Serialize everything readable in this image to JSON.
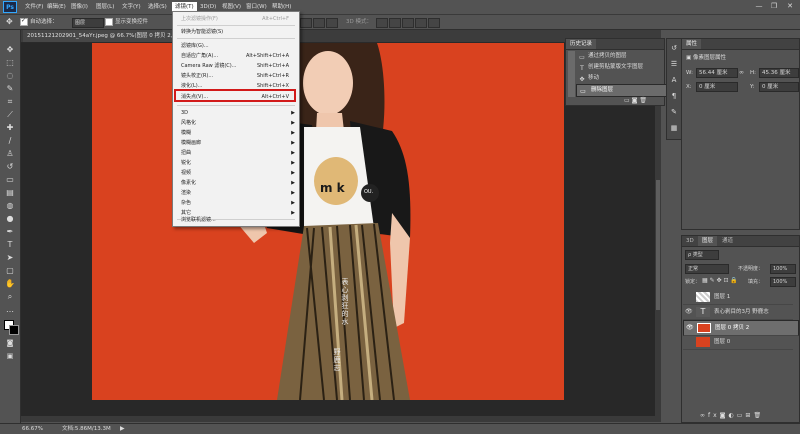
{
  "menubar": {
    "items": [
      "文件(F)",
      "编辑(E)",
      "图像(I)",
      "图层(L)",
      "文字(Y)",
      "选择(S)",
      "滤镜(T)",
      "3D(D)",
      "视图(V)",
      "窗口(W)",
      "帮助(H)"
    ],
    "active_index": 6,
    "window_controls": [
      "—",
      "❐",
      "✕"
    ]
  },
  "options": {
    "auto_select_label": "自动选择：",
    "auto_select_value": "图层",
    "show_transform_label": "显示变换控件",
    "mode_3d_label": "3D 模式："
  },
  "document": {
    "tab_title": "20151121202901_54aYr.jpeg @ 66.7%(图层 0 拷贝 2, RGB/8)",
    "zoom": "66.67%",
    "doc_info": "文档:5.86M/13.3M"
  },
  "filter_menu": {
    "items": [
      {
        "label": "上次滤镜操作(F)",
        "shortcut": "Alt+Ctrl+F",
        "disabled": true
      },
      {
        "label": "转换为智能滤镜(S)",
        "shortcut": ""
      },
      {
        "label": "滤镜库(G)...",
        "shortcut": ""
      },
      {
        "label": "自适应广角(A)...",
        "shortcut": "Alt+Shift+Ctrl+A"
      },
      {
        "label": "Camera Raw 滤镜(C)...",
        "shortcut": "Shift+Ctrl+A"
      },
      {
        "label": "镜头校正(R)...",
        "shortcut": "Shift+Ctrl+R"
      },
      {
        "label": "液化(L)...",
        "shortcut": "Shift+Ctrl+X"
      },
      {
        "label": "消失点(V)...",
        "shortcut": "Alt+Ctrl+V"
      },
      {
        "label": "3D",
        "submenu": true
      },
      {
        "label": "风格化",
        "submenu": true
      },
      {
        "label": "模糊",
        "submenu": true
      },
      {
        "label": "模糊画廊",
        "submenu": true
      },
      {
        "label": "扭曲",
        "submenu": true
      },
      {
        "label": "锐化",
        "submenu": true
      },
      {
        "label": "视频",
        "submenu": true
      },
      {
        "label": "像素化",
        "submenu": true
      },
      {
        "label": "渲染",
        "submenu": true
      },
      {
        "label": "杂色",
        "submenu": true
      },
      {
        "label": "其它",
        "submenu": true
      },
      {
        "label": "浏览联机滤镜...",
        "shortcut": ""
      }
    ],
    "highlighted_index": 7,
    "highlight_color": "#d21a1a"
  },
  "history": {
    "title": "历史记录",
    "items": [
      {
        "label": "通过拷贝的图层",
        "icon": "document-icon"
      },
      {
        "label": "创建剪贴蒙版文字图层",
        "icon": "text-icon"
      },
      {
        "label": "移动",
        "icon": "move-icon"
      },
      {
        "label": "删除图层",
        "icon": "document-icon"
      }
    ],
    "selected_index": 3
  },
  "properties": {
    "title": "属性",
    "subtitle": "像素图层属性",
    "w_label": "W:",
    "w_value": "56.44 厘米",
    "link_icon": "∞",
    "h_label": "H:",
    "h_value": "45.36 厘米",
    "x_label": "X:",
    "x_value": "0 厘米",
    "y_label": "Y:",
    "y_value": "0 厘米"
  },
  "layers_panel": {
    "tabs": [
      "3D",
      "图层",
      "通道"
    ],
    "active_tab": 1,
    "kind_label": "ρ 类型",
    "blend_mode": "正常",
    "opacity_label": "不透明度：",
    "opacity_value": "100%",
    "lock_label": "锁定：",
    "fill_label": "填充：",
    "fill_value": "100%",
    "layers": [
      {
        "name": "图层 1",
        "visible": false,
        "type": "transparent"
      },
      {
        "name": "表心剥目的3月 野鹿志",
        "visible": true,
        "type": "text"
      },
      {
        "name": "图层 0 拷贝 2",
        "visible": true,
        "type": "photo",
        "selected": true
      },
      {
        "name": "图层 0",
        "visible": false,
        "type": "photo"
      }
    ]
  },
  "canvas_text": {
    "shirt": "m   k",
    "badge": "OU.",
    "vertical": [
      "表心剥狂的水",
      "野鹿志"
    ]
  },
  "colors": {
    "photo_bg": "#d9421f",
    "ui_bg": "#535353",
    "canvas_bg": "#282828",
    "accent": "#31a8ff"
  }
}
